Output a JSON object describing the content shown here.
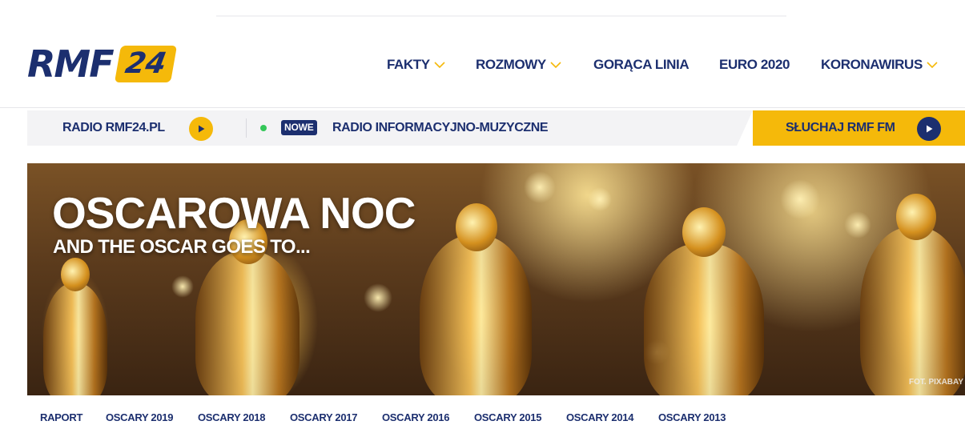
{
  "brand": {
    "logo_text": "RMF",
    "logo_number": "24",
    "accent_color": "#f5b90a",
    "primary_color": "#1c2f6f"
  },
  "nav": {
    "items": [
      {
        "label": "FAKTY",
        "has_dropdown": true
      },
      {
        "label": "ROZMOWY",
        "has_dropdown": true
      },
      {
        "label": "GORĄCA LINIA",
        "has_dropdown": false
      },
      {
        "label": "EURO 2020",
        "has_dropdown": false
      },
      {
        "label": "KORONAWIRUS",
        "has_dropdown": true
      }
    ]
  },
  "radio_bar": {
    "radio_label": "RADIO RMF24.PL",
    "badge": "NOWE",
    "info_label": "RADIO INFORMACYJNO-MUZYCZNE",
    "listen_label": "SŁUCHAJ RMF FM",
    "play_icon": "play-icon"
  },
  "hero": {
    "title": "OSCAROWA NOC",
    "subtitle": "AND THE OSCAR GOES TO...",
    "credit": "FOT. PIXABAY"
  },
  "tabs": [
    "RAPORT",
    "OSCARY 2019",
    "OSCARY 2018",
    "OSCARY 2017",
    "OSCARY 2016",
    "OSCARY 2015",
    "OSCARY 2014",
    "OSCARY 2013"
  ]
}
